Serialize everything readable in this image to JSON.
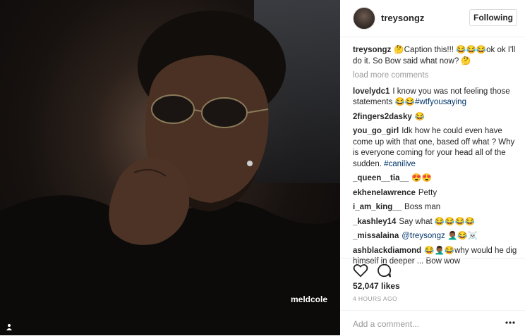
{
  "post": {
    "photo_credit": "meldcole",
    "author": "treysongz",
    "follow_label": "Following",
    "load_more": "load more comments",
    "likes": "52,047 likes",
    "time": "4 HOURS AGO",
    "add_comment_placeholder": "Add a comment..."
  },
  "comments": [
    {
      "user": "treysongz",
      "text": "🤔Caption this!!! 😂😂😂ok ok I'll do it. So Bow said what now? 🤔",
      "tag": ""
    },
    {
      "user": "lovelydc1",
      "text": "I know you was not feeling those statements 😂😂",
      "tag": "#wtfyousaying"
    },
    {
      "user": "2fingers2dasky",
      "text": "😂",
      "tag": ""
    },
    {
      "user": "you_go_girl",
      "text": "Idk how he could even have come up with that one, based off what ? Why is everyone coming for your head all of the sudden.",
      "tag": "#canilive"
    },
    {
      "user": "_queen__tia__",
      "text": "😍😍",
      "tag": ""
    },
    {
      "user": "ekhenelawrence",
      "text": "Petty",
      "tag": ""
    },
    {
      "user": "i_am_king__",
      "text": "Boss man",
      "tag": ""
    },
    {
      "user": "_kashley14",
      "text": "Say what 😂😂😂😂",
      "tag": ""
    },
    {
      "user": "_missalaina",
      "text": "",
      "tag": "@treysongz",
      "after": "🤦🏾‍♂️😂☠️"
    },
    {
      "user": "ashblackdiamond",
      "text": "😂🤦🏾‍♂️😂why would he dig himself in deeper ... Bow wow",
      "tag": ""
    }
  ]
}
